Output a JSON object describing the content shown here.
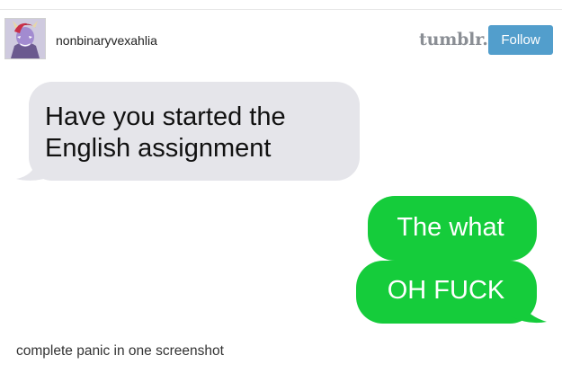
{
  "post": {
    "username": "nonbinaryvexahlia",
    "caption": "complete panic in one screenshot"
  },
  "header": {
    "logo_text": "tumblr.",
    "follow_label": "Follow"
  },
  "conversation": {
    "incoming": [
      {
        "text": "Have you started the English assignment"
      }
    ],
    "outgoing": [
      {
        "text": "The what"
      },
      {
        "text": "OH FUCK"
      }
    ]
  },
  "colors": {
    "follow_button": "#529ecc",
    "incoming_bubble": "#e5e5ea",
    "outgoing_bubble": "#15cc3b",
    "logo": "#8a8e94"
  }
}
